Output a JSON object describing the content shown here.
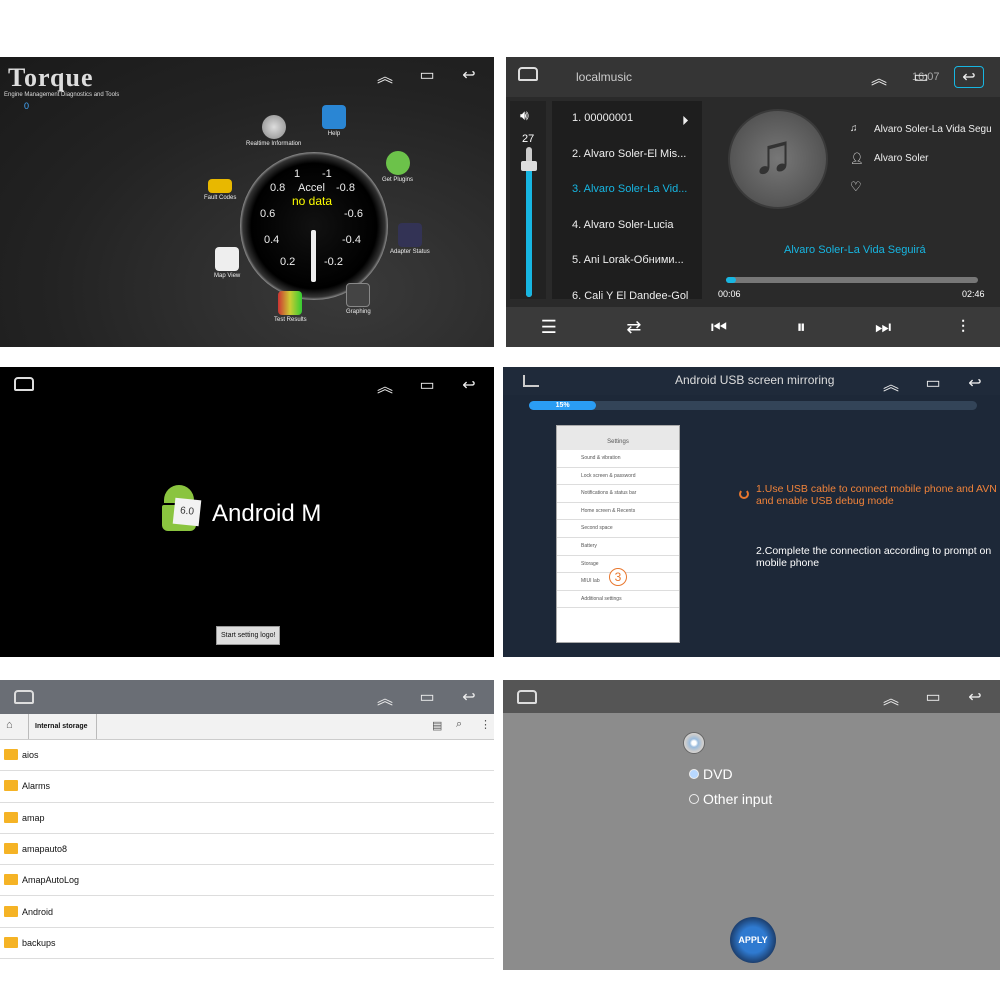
{
  "torque": {
    "title": "Torque",
    "subtitle": "Engine Management Diagnostics and Tools",
    "status_value": "0",
    "gauge": {
      "label": "Accel",
      "value": "no data",
      "ticks": [
        "1",
        "-1",
        "0.8",
        "-0.8",
        "0.6",
        "-0.6",
        "0.4",
        "-0.4",
        "0.2",
        "-0.2"
      ]
    },
    "icons": [
      {
        "label": "Realtime Information"
      },
      {
        "label": "Help"
      },
      {
        "label": "Get Plugins"
      },
      {
        "label": "Fault Codes"
      },
      {
        "label": "Adapter Status"
      },
      {
        "label": "Map View"
      },
      {
        "label": "Graphing"
      },
      {
        "label": "Test Results"
      }
    ]
  },
  "music": {
    "source_title": "localmusic",
    "status_time": "16:07",
    "volume": "27",
    "tracks": [
      "1. 00000001",
      "2. Alvaro Soler-El Mis...",
      "3. Alvaro Soler-La Vid...",
      "4. Alvaro Soler-Lucia",
      "5. Ani Lorak-Обними...",
      "6. Cali Y El Dandee-Gol"
    ],
    "song_title": "Alvaro Soler-La Vida Segu",
    "artist": "Alvaro Soler",
    "now_playing": "Alvaro Soler-La Vida Seguirá",
    "elapsed": "00:06",
    "duration": "02:46",
    "progress_percent": 4
  },
  "android": {
    "version_badge": "6.0",
    "name": "Android M",
    "setting_button": "Start setting logo!"
  },
  "mirroring": {
    "title": "Android USB screen mirroring",
    "progress_label": "15%",
    "progress_percent": 15,
    "phone_title": "Settings",
    "phone_rows": [
      "Sound & vibration",
      "Lock screen & password",
      "Notifications & status bar",
      "Home screen & Recents",
      "Second space",
      "Battery",
      "Storage",
      "MIUI lab",
      "Additional settings"
    ],
    "step_badge": "3",
    "step1": "1.Use USB cable to connect mobile phone and AVN and enable USB debug mode",
    "step2": "2.Complete the connection according to prompt on mobile phone"
  },
  "files": {
    "breadcrumb": "Internal storage",
    "folders": [
      "aios",
      "Alarms",
      "amap",
      "amapauto8",
      "AmapAutoLog",
      "Android",
      "backups"
    ]
  },
  "dvd": {
    "options": [
      "DVD",
      "Other input"
    ],
    "selected": "DVD",
    "apply_label": "APPLY"
  }
}
